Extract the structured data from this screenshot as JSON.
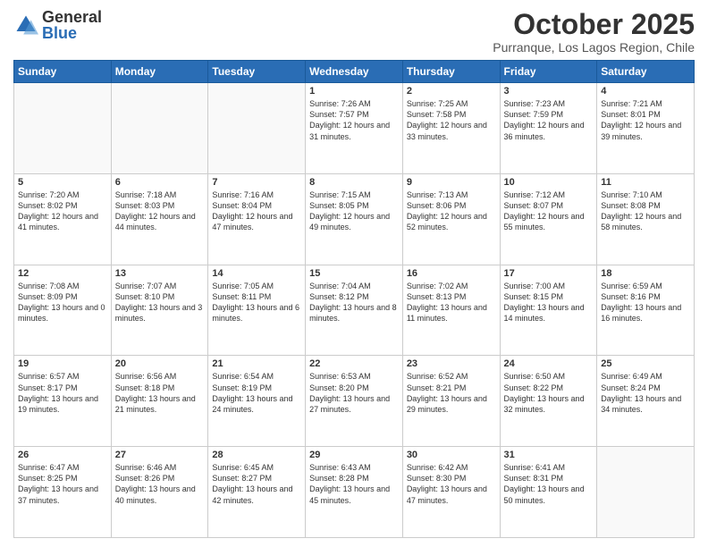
{
  "logo": {
    "general": "General",
    "blue": "Blue"
  },
  "header": {
    "month": "October 2025",
    "location": "Purranque, Los Lagos Region, Chile"
  },
  "days_of_week": [
    "Sunday",
    "Monday",
    "Tuesday",
    "Wednesday",
    "Thursday",
    "Friday",
    "Saturday"
  ],
  "weeks": [
    [
      {
        "day": "",
        "info": ""
      },
      {
        "day": "",
        "info": ""
      },
      {
        "day": "",
        "info": ""
      },
      {
        "day": "1",
        "info": "Sunrise: 7:26 AM\nSunset: 7:57 PM\nDaylight: 12 hours and 31 minutes."
      },
      {
        "day": "2",
        "info": "Sunrise: 7:25 AM\nSunset: 7:58 PM\nDaylight: 12 hours and 33 minutes."
      },
      {
        "day": "3",
        "info": "Sunrise: 7:23 AM\nSunset: 7:59 PM\nDaylight: 12 hours and 36 minutes."
      },
      {
        "day": "4",
        "info": "Sunrise: 7:21 AM\nSunset: 8:01 PM\nDaylight: 12 hours and 39 minutes."
      }
    ],
    [
      {
        "day": "5",
        "info": "Sunrise: 7:20 AM\nSunset: 8:02 PM\nDaylight: 12 hours and 41 minutes."
      },
      {
        "day": "6",
        "info": "Sunrise: 7:18 AM\nSunset: 8:03 PM\nDaylight: 12 hours and 44 minutes."
      },
      {
        "day": "7",
        "info": "Sunrise: 7:16 AM\nSunset: 8:04 PM\nDaylight: 12 hours and 47 minutes."
      },
      {
        "day": "8",
        "info": "Sunrise: 7:15 AM\nSunset: 8:05 PM\nDaylight: 12 hours and 49 minutes."
      },
      {
        "day": "9",
        "info": "Sunrise: 7:13 AM\nSunset: 8:06 PM\nDaylight: 12 hours and 52 minutes."
      },
      {
        "day": "10",
        "info": "Sunrise: 7:12 AM\nSunset: 8:07 PM\nDaylight: 12 hours and 55 minutes."
      },
      {
        "day": "11",
        "info": "Sunrise: 7:10 AM\nSunset: 8:08 PM\nDaylight: 12 hours and 58 minutes."
      }
    ],
    [
      {
        "day": "12",
        "info": "Sunrise: 7:08 AM\nSunset: 8:09 PM\nDaylight: 13 hours and 0 minutes."
      },
      {
        "day": "13",
        "info": "Sunrise: 7:07 AM\nSunset: 8:10 PM\nDaylight: 13 hours and 3 minutes."
      },
      {
        "day": "14",
        "info": "Sunrise: 7:05 AM\nSunset: 8:11 PM\nDaylight: 13 hours and 6 minutes."
      },
      {
        "day": "15",
        "info": "Sunrise: 7:04 AM\nSunset: 8:12 PM\nDaylight: 13 hours and 8 minutes."
      },
      {
        "day": "16",
        "info": "Sunrise: 7:02 AM\nSunset: 8:13 PM\nDaylight: 13 hours and 11 minutes."
      },
      {
        "day": "17",
        "info": "Sunrise: 7:00 AM\nSunset: 8:15 PM\nDaylight: 13 hours and 14 minutes."
      },
      {
        "day": "18",
        "info": "Sunrise: 6:59 AM\nSunset: 8:16 PM\nDaylight: 13 hours and 16 minutes."
      }
    ],
    [
      {
        "day": "19",
        "info": "Sunrise: 6:57 AM\nSunset: 8:17 PM\nDaylight: 13 hours and 19 minutes."
      },
      {
        "day": "20",
        "info": "Sunrise: 6:56 AM\nSunset: 8:18 PM\nDaylight: 13 hours and 21 minutes."
      },
      {
        "day": "21",
        "info": "Sunrise: 6:54 AM\nSunset: 8:19 PM\nDaylight: 13 hours and 24 minutes."
      },
      {
        "day": "22",
        "info": "Sunrise: 6:53 AM\nSunset: 8:20 PM\nDaylight: 13 hours and 27 minutes."
      },
      {
        "day": "23",
        "info": "Sunrise: 6:52 AM\nSunset: 8:21 PM\nDaylight: 13 hours and 29 minutes."
      },
      {
        "day": "24",
        "info": "Sunrise: 6:50 AM\nSunset: 8:22 PM\nDaylight: 13 hours and 32 minutes."
      },
      {
        "day": "25",
        "info": "Sunrise: 6:49 AM\nSunset: 8:24 PM\nDaylight: 13 hours and 34 minutes."
      }
    ],
    [
      {
        "day": "26",
        "info": "Sunrise: 6:47 AM\nSunset: 8:25 PM\nDaylight: 13 hours and 37 minutes."
      },
      {
        "day": "27",
        "info": "Sunrise: 6:46 AM\nSunset: 8:26 PM\nDaylight: 13 hours and 40 minutes."
      },
      {
        "day": "28",
        "info": "Sunrise: 6:45 AM\nSunset: 8:27 PM\nDaylight: 13 hours and 42 minutes."
      },
      {
        "day": "29",
        "info": "Sunrise: 6:43 AM\nSunset: 8:28 PM\nDaylight: 13 hours and 45 minutes."
      },
      {
        "day": "30",
        "info": "Sunrise: 6:42 AM\nSunset: 8:30 PM\nDaylight: 13 hours and 47 minutes."
      },
      {
        "day": "31",
        "info": "Sunrise: 6:41 AM\nSunset: 8:31 PM\nDaylight: 13 hours and 50 minutes."
      },
      {
        "day": "",
        "info": ""
      }
    ]
  ]
}
